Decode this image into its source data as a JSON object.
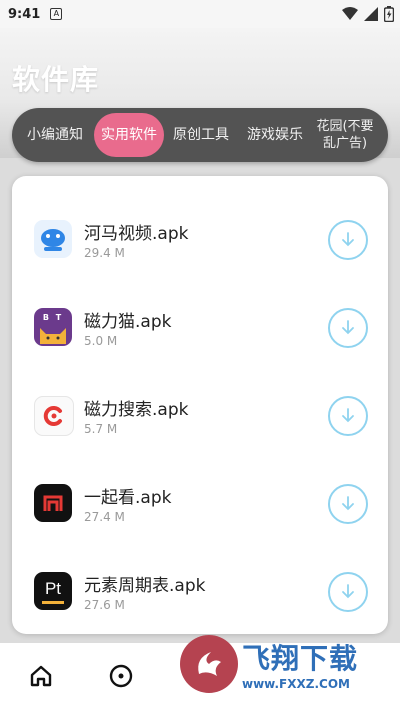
{
  "status_bar": {
    "time": "9:41",
    "note_glyph": "A"
  },
  "page_title": "软件库",
  "tabs": [
    {
      "label": "小编通知",
      "selected": false
    },
    {
      "label": "实用软件",
      "selected": true
    },
    {
      "label": "原创工具",
      "selected": false
    },
    {
      "label": "游戏娱乐",
      "selected": false
    },
    {
      "label": "花园(不要乱广告)",
      "selected": false
    }
  ],
  "apps": [
    {
      "name": "河马视频.apk",
      "size": "29.4 M",
      "icon": "hippo-video-icon",
      "color": "#2f86e6"
    },
    {
      "name": "磁力猫.apk",
      "size": "5.0 M",
      "icon": "cat-icon",
      "color": "#6b3a8c"
    },
    {
      "name": "磁力搜索.apk",
      "size": "5.7 M",
      "icon": "magnet-search-icon",
      "color": "#e53935"
    },
    {
      "name": "一起看.apk",
      "size": "27.4 M",
      "icon": "watch-together-icon",
      "color": "#111111"
    },
    {
      "name": "元素周期表.apk",
      "size": "27.6 M",
      "icon": "periodic-table-icon",
      "color": "#111111"
    }
  ],
  "icon_glyphs": {
    "bt": "B T",
    "pt": "Pt"
  },
  "colors": {
    "tab_selected": "#e96b8d",
    "tab_bar": "#535353",
    "download_ring": "#8fd3ef"
  },
  "watermark": {
    "cn": "飞翔下载",
    "en": "www.FXXZ.COM"
  }
}
